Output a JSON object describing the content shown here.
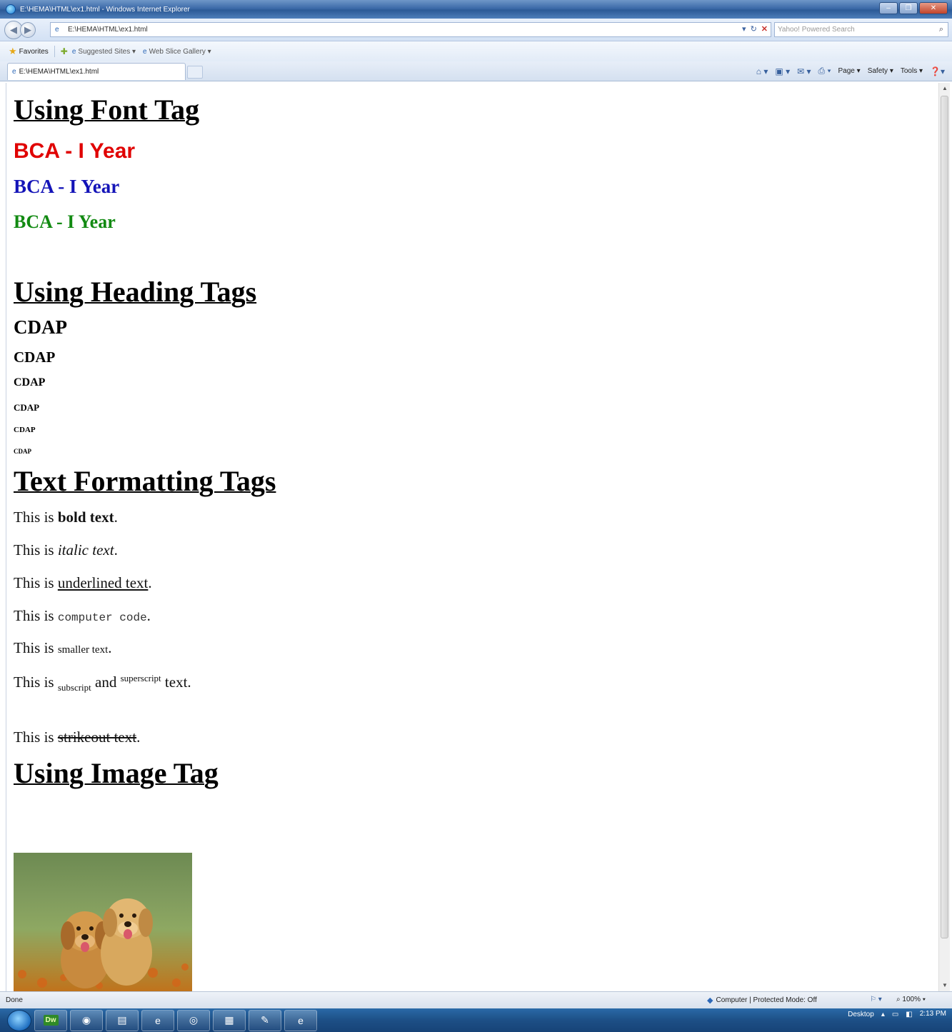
{
  "window": {
    "title": "E:\\HEMA\\HTML\\ex1.html - Windows Internet Explorer"
  },
  "addressbar": {
    "url": "E:\\HEMA\\HTML\\ex1.html",
    "search_placeholder": "Yahoo! Powered Search"
  },
  "favorites": {
    "label": "Favorites",
    "items": [
      "Suggested Sites",
      "Web Slice Gallery"
    ]
  },
  "tab": {
    "title": "E:\\HEMA\\HTML\\ex1.html"
  },
  "commandbar": {
    "items": [
      "Page",
      "Safety",
      "Tools"
    ]
  },
  "content": {
    "font_section": {
      "heading": "Using Font Tag",
      "lines": [
        {
          "text": "BCA - I Year",
          "color": "#e00000"
        },
        {
          "text": "BCA - I Year",
          "color": "#1414b8"
        },
        {
          "text": "BCA - I Year",
          "color": "#128a12"
        }
      ]
    },
    "heading_section": {
      "heading": "Using Heading Tags",
      "items": [
        "CDAP",
        "CDAP",
        "CDAP",
        "CDAP",
        "CDAP",
        "CDAP"
      ]
    },
    "formatting_section": {
      "heading": "Text Formatting Tags",
      "prefix": "This is",
      "bold": "bold text",
      "italic": "italic text",
      "underline": "underlined text",
      "code": "computer code",
      "small": "smaller text",
      "subscript": "subscript",
      "and": "and",
      "superscript": "superscript",
      "text_word": "text",
      "strike": "strikeout text",
      "period": "."
    },
    "image_section": {
      "heading": "Using Image Tag"
    }
  },
  "statusbar": {
    "status": "Done",
    "zone": "Computer | Protected Mode: Off",
    "zoom": "100%"
  },
  "taskbar": {
    "desktop_label": "Desktop",
    "time": "2:13 PM"
  }
}
